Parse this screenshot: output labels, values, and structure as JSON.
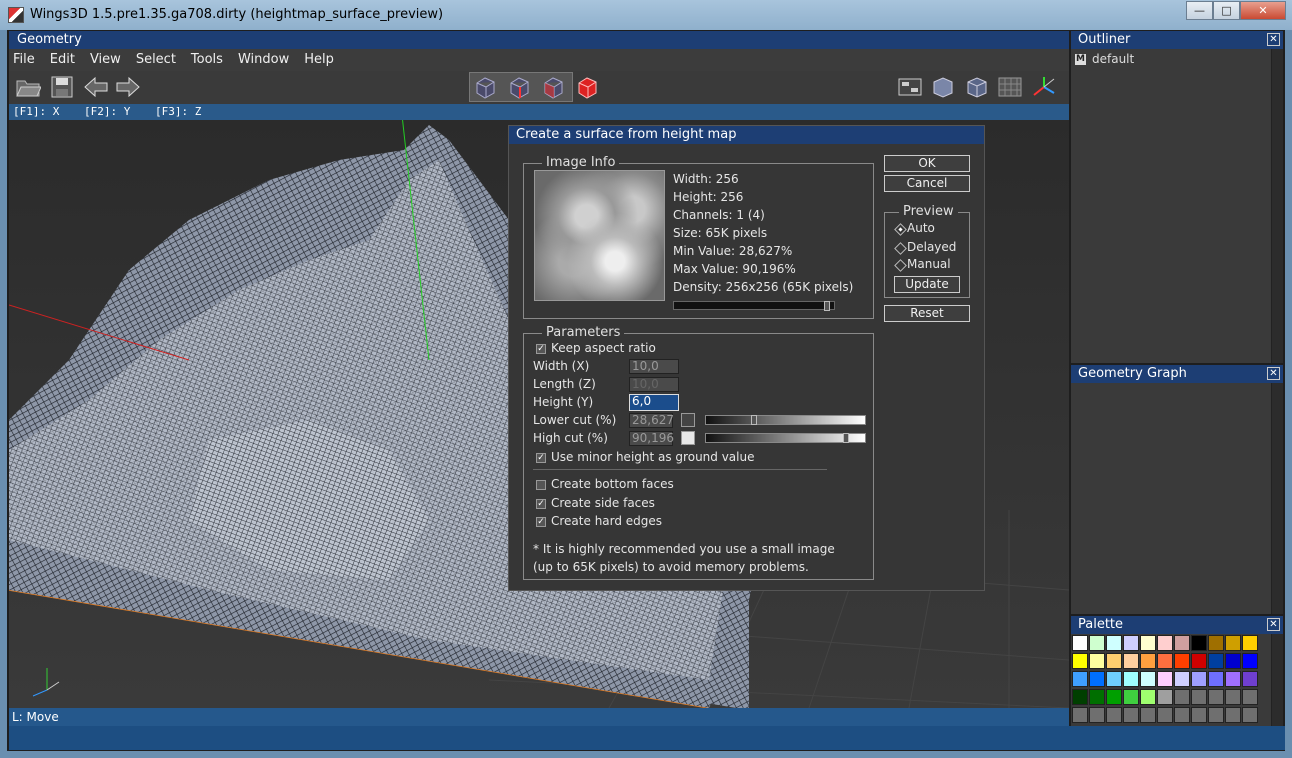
{
  "os_window": {
    "title": "Wings3D 1.5.pre1.35.ga708.dirty (heightmap_surface_preview)",
    "minimize": "—",
    "maximize": "□",
    "close": "✕"
  },
  "geometry": {
    "title": "Geometry",
    "menu": [
      "File",
      "Edit",
      "View",
      "Select",
      "Tools",
      "Window",
      "Help"
    ],
    "axis_hints": [
      "[F1]: X",
      "[F2]: Y",
      "[F3]: Z"
    ],
    "axis_y_label": "Y",
    "status": "L: Move"
  },
  "outliner": {
    "title": "Outliner",
    "item": "default",
    "item_icon": "M"
  },
  "geometry_graph": {
    "title": "Geometry Graph"
  },
  "palette": {
    "title": "Palette",
    "colors": [
      "#ffffff",
      "#cfffcf",
      "#cfffff",
      "#cfcfff",
      "#ffffcf",
      "#ffcfcf",
      "#cf9f9f",
      "#000000",
      "#9f6f00",
      "#cf9f00",
      "#ffcf00",
      "#ffff00",
      "#ffff9f",
      "#ffcf6f",
      "#ffcf9f",
      "#ff9f3f",
      "#ff6f3f",
      "#ff3f00",
      "#cf0000",
      "#003f9f",
      "#0000cf",
      "#0000ff",
      "#3f9fff",
      "#006fff",
      "#6fcfff",
      "#9fffff",
      "#cfffff",
      "#ffcfff",
      "#cfcfff",
      "#9f9fff",
      "#6f6fff",
      "#9f6fff",
      "#6f3fcf",
      "#003f00",
      "#006f00",
      "#009f00",
      "#3fcf3f",
      "#9fff6f",
      "#9f9f9f",
      "#6f6f6f",
      "#6f6f6f",
      "#6f6f6f",
      "#6f6f6f",
      "#6f6f6f",
      "#6f6f6f",
      "#6f6f6f",
      "#6f6f6f",
      "#6f6f6f",
      "#6f6f6f",
      "#6f6f6f",
      "#6f6f6f",
      "#6f6f6f",
      "#6f6f6f",
      "#6f6f6f",
      "#6f6f6f"
    ]
  },
  "dialog": {
    "title": "Create a surface from height map",
    "image_info": {
      "label": "Image Info",
      "width": "Width: 256",
      "height": "Height: 256",
      "channels": "Channels: 1 (4)",
      "size": "Size: 65K pixels",
      "min_value": "Min Value: 28,627%",
      "max_value": "Max Value: 90,196%",
      "density": "Density:  256x256 (65K pixels)"
    },
    "ok": "OK",
    "cancel": "Cancel",
    "preview": {
      "label": "Preview",
      "options": [
        "Auto",
        "Delayed",
        "Manual"
      ],
      "selected": "Auto",
      "update": "Update"
    },
    "reset": "Reset",
    "parameters": {
      "label": "Parameters",
      "keep_aspect": "Keep aspect ratio",
      "width_label": "Width (X)",
      "width_value": "10,0",
      "length_label": "Length (Z)",
      "length_value": "10,0",
      "height_label": "Height (Y)",
      "height_value": "6,0",
      "lower_cut_label": "Lower cut (%)",
      "lower_cut_value": "28,627",
      "high_cut_label": "High cut (%)",
      "high_cut_value": "90,196",
      "use_minor": "Use minor height as ground value",
      "bottom_faces": "Create bottom faces",
      "side_faces": "Create side faces",
      "hard_edges": "Create hard edges",
      "note_line1": "* It is highly recommended you use a small image",
      "note_line2": "(up to 65K pixels) to avoid memory problems."
    }
  }
}
